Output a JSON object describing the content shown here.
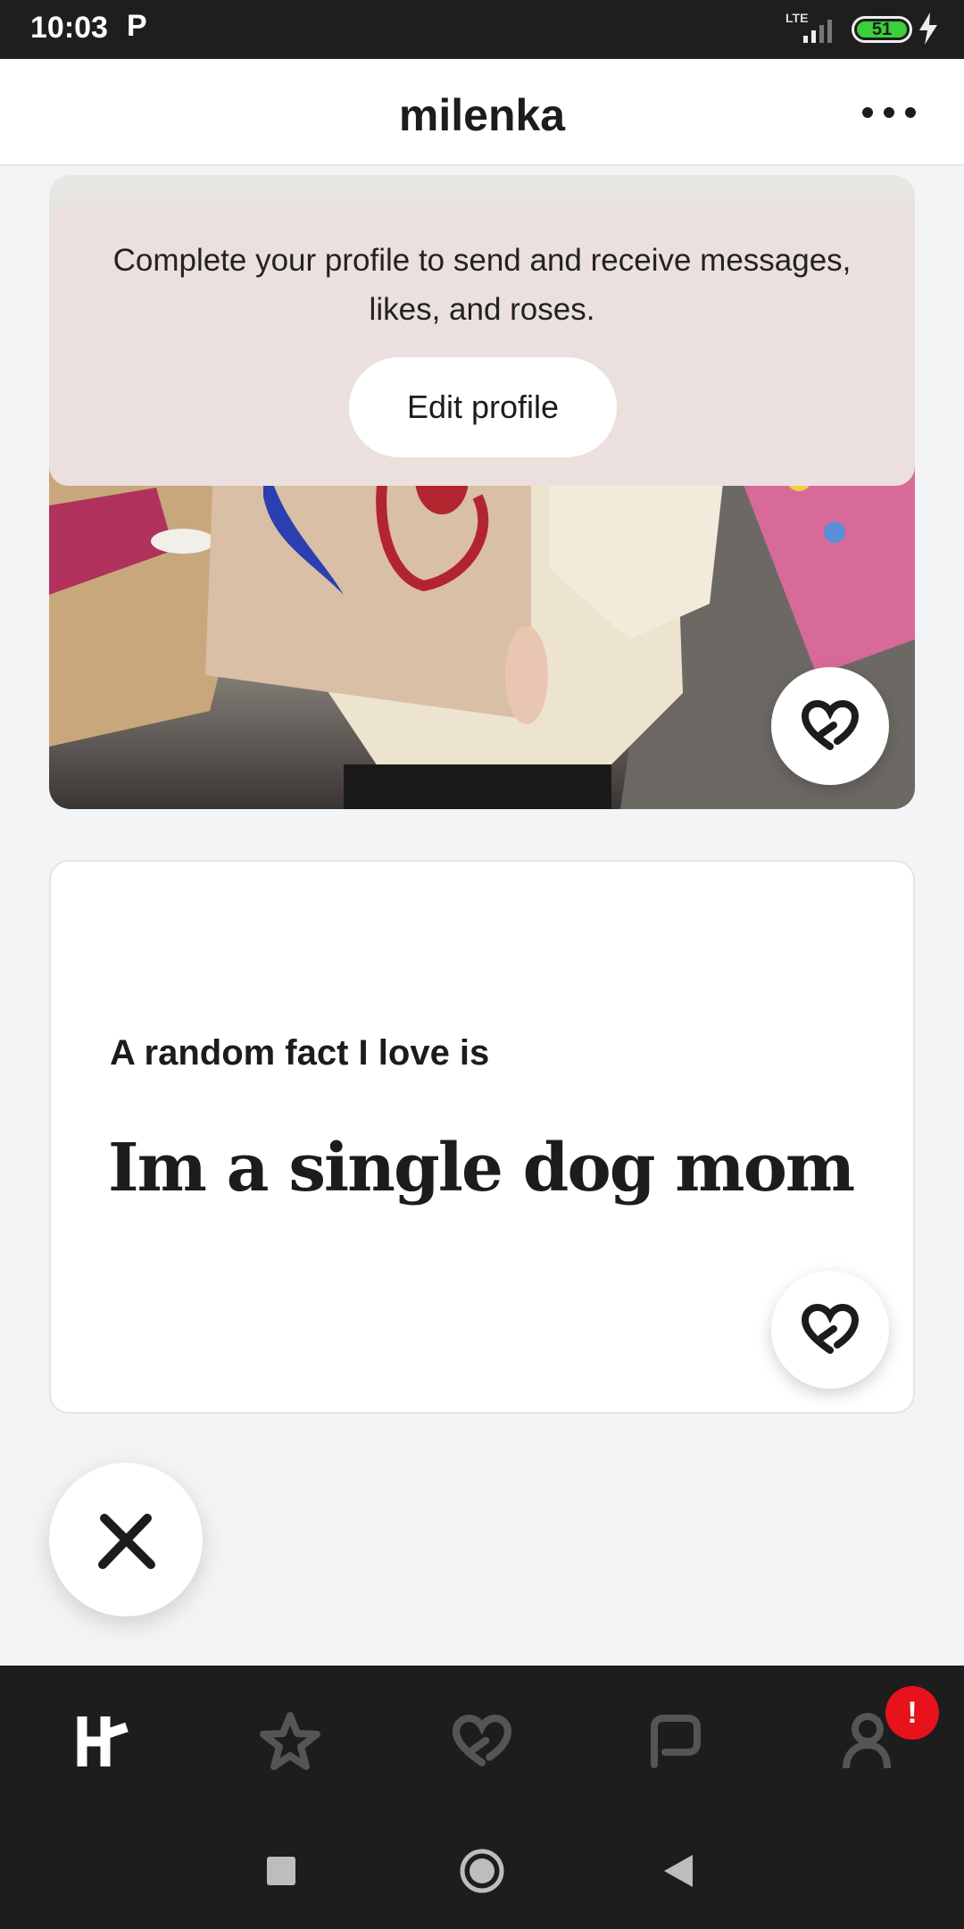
{
  "status_bar": {
    "time": "10:03",
    "app_indicator": "P",
    "network": "LTE",
    "battery": "51"
  },
  "header": {
    "title": "milenka",
    "menu_icon": "more-icon"
  },
  "banner": {
    "message": "Complete your profile to send and receive messages, likes, and roses.",
    "button_label": "Edit profile"
  },
  "prompt": {
    "question": "A random fact I love is",
    "answer": "Im a single dog mom"
  },
  "bottom_nav": {
    "items": [
      "home-icon",
      "star-icon",
      "heart-icon",
      "chat-icon",
      "profile-icon"
    ],
    "badge": "!"
  },
  "colors": {
    "banner_bg": "#ebe0dd",
    "badge": "#e8121c",
    "nav_bg": "#1d1d1d"
  }
}
